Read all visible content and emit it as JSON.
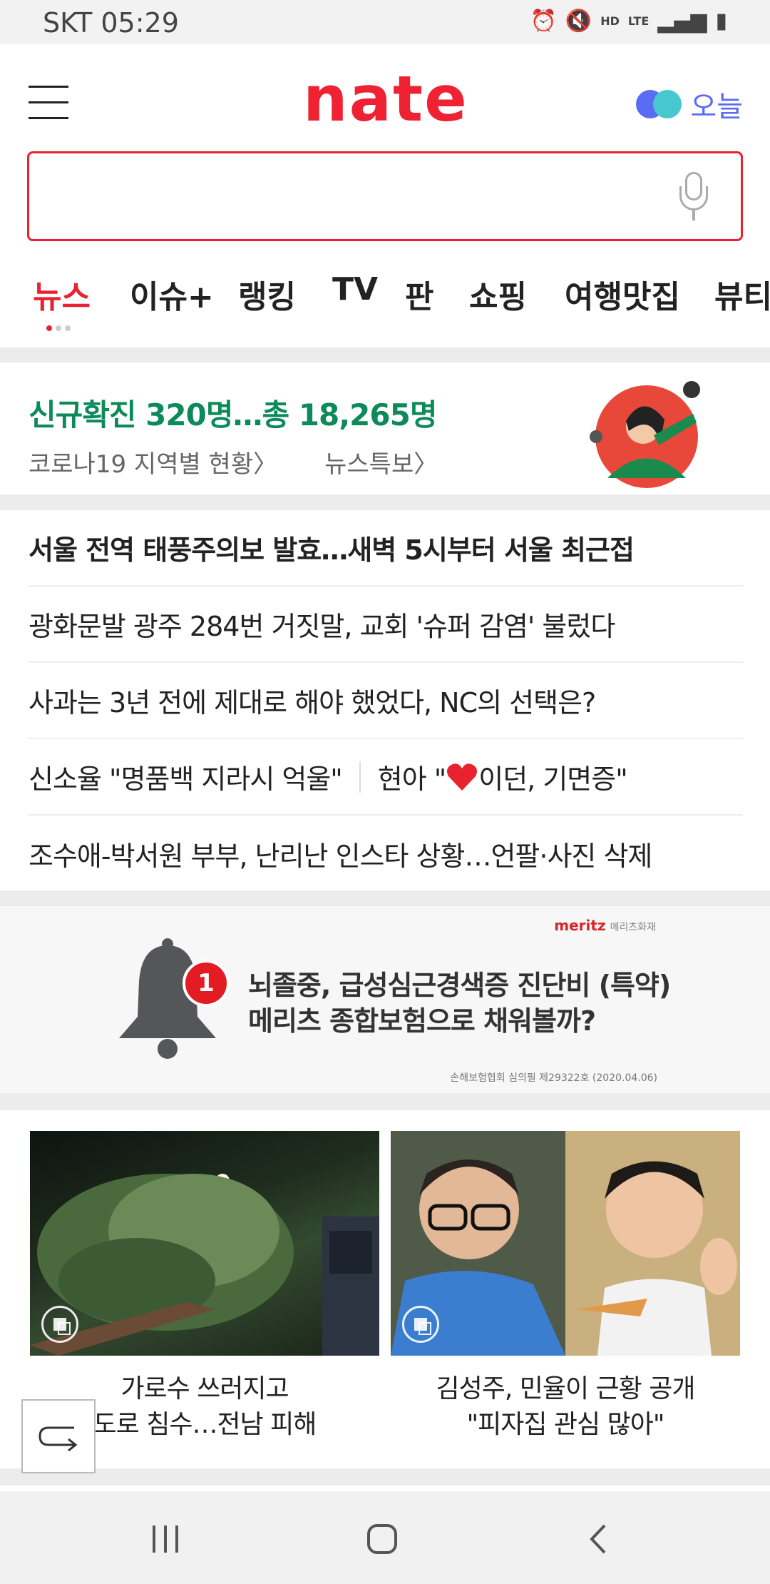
{
  "status": {
    "carrier_time": "SKT 05:29",
    "icons": [
      "alarm-icon",
      "mute-icon",
      "hd-voice-icon",
      "lte-icon",
      "signal-icon",
      "battery-icon"
    ]
  },
  "header": {
    "logo": "nate",
    "today_label": "오늘"
  },
  "search": {
    "value": "",
    "placeholder": ""
  },
  "tabs": [
    {
      "label": "뉴스",
      "active": true
    },
    {
      "label": "이슈+"
    },
    {
      "label": "랭킹"
    },
    {
      "label": "TV"
    },
    {
      "label": "판"
    },
    {
      "label": "쇼핑"
    },
    {
      "label": "여행맛집"
    },
    {
      "label": "뷰티"
    }
  ],
  "covid": {
    "headline": "신규확진 320명…총 18,265명",
    "link1": "코로나19 지역별 현황〉",
    "link2": "뉴스특보〉"
  },
  "news": [
    "서울 전역 태풍주의보 발효…새벽 5시부터 서울 최근접",
    "광화문발 광주 284번 거짓말, 교회 '슈퍼 감염' 불렀다",
    "사과는 3년 전에 제대로 해야 했었다, NC의 선택은?",
    "신소율 \"명품백 지라시 억울\"",
    "현아 \"",
    "이던, 기면증\"",
    "조수애-박서원 부부, 난리난 인스타 상황…언팔·사진 삭제"
  ],
  "ad": {
    "brand": "meritz",
    "brand_sub": "메리츠화재",
    "badge": "1",
    "line1": "뇌졸중, 급성심근경색증 진단비 (특약)",
    "line2": "메리츠 종합보험으로 채워볼까?",
    "note": "손해보험협회 심의필 제29322호 (2020.04.06)"
  },
  "cards": [
    {
      "line1": "가로수 쓰러지고",
      "line2": "도로 침수…전남 피해"
    },
    {
      "line1": "김성주, 민율이 근황 공개",
      "line2": "\"피자집 관심 많아\""
    }
  ],
  "colors": {
    "brand_red": "#e8222f",
    "covid_green": "#0d8a5a",
    "today_blue": "#5a6cf3",
    "today_teal": "#46c8cf"
  }
}
